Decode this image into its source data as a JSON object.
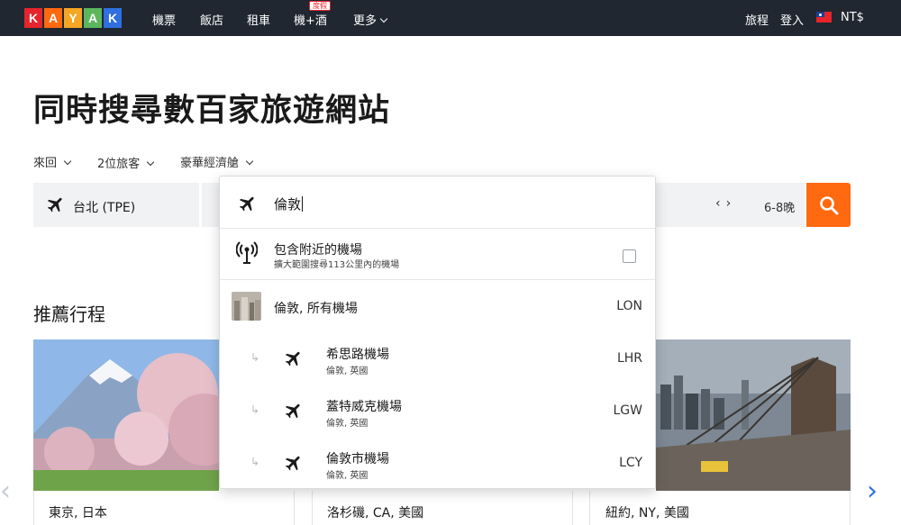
{
  "nav": {
    "logo_letters": [
      "K",
      "A",
      "Y",
      "A",
      "K"
    ],
    "logo_colors": [
      "#e5242b",
      "#ff690f",
      "#f5a623",
      "#5bb65e",
      "#2f6fe0"
    ],
    "items": [
      {
        "label": "機票"
      },
      {
        "label": "飯店"
      },
      {
        "label": "租車"
      },
      {
        "label": "機+酒",
        "badge": "度假"
      },
      {
        "label": "更多"
      }
    ],
    "trips": "旅程",
    "login": "登入",
    "currency": "NT$"
  },
  "headline": "同時搜尋數百家旅遊網站",
  "options": {
    "trip_type": "來回",
    "travelers": "2位旅客",
    "cabin": "豪華經濟艙"
  },
  "search": {
    "origin": "台北 (TPE)",
    "flex_days": "6-8晚",
    "destination_value": "倫敦"
  },
  "dropdown": {
    "nearby": {
      "title": "包含附近的機場",
      "subtitle": "擴大範圍搜尋113公里內的機場"
    },
    "results": [
      {
        "name": "倫敦, 所有機場",
        "code": "LON"
      },
      {
        "name": "希思路機場",
        "location": "倫敦, 英國",
        "code": "LHR"
      },
      {
        "name": "蓋特威克機場",
        "location": "倫敦, 英國",
        "code": "LGW"
      },
      {
        "name": "倫敦市機場",
        "location": "倫敦, 英國",
        "code": "LCY"
      }
    ]
  },
  "recommended": {
    "title": "推薦行程",
    "cards": [
      {
        "label": "東京, 日本"
      },
      {
        "label": "洛杉磯, CA, 美國"
      },
      {
        "label": "紐約, NY, 美國"
      }
    ]
  },
  "colors": {
    "nav_bg": "#202731",
    "accent": "#ff690f",
    "field_bg": "#f1f2f4"
  },
  "icons": {
    "plane": "plane-icon",
    "antenna": "antenna-icon",
    "search": "search-icon"
  }
}
